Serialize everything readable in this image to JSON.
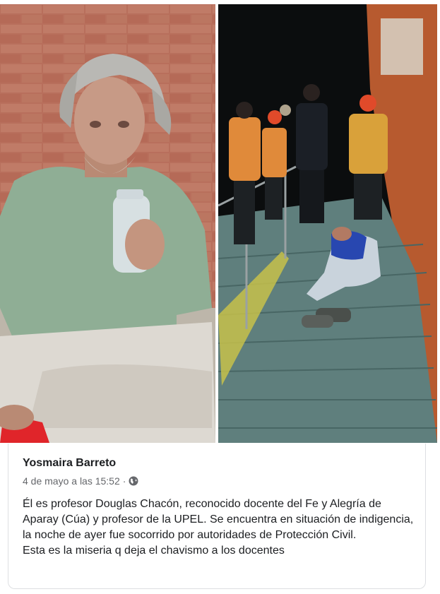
{
  "post": {
    "author": "Yosmaira Barreto",
    "timestamp": "4 de mayo a las 15:52",
    "separator": "·",
    "privacy_icon": "globe-icon",
    "text_paragraphs": [
      "Él es profesor Douglas Chacón, reconocido docente del Fe y Alegría de Aparay (Cúa) y profesor de la UPEL. Se encuentra en situación de indigencia, la noche de ayer fue socorrido por autoridades de Protección Civil.",
      "Esta es la miseria q deja el chavismo a los docentes"
    ]
  },
  "photos": [
    {
      "id": "photo-left"
    },
    {
      "id": "photo-right"
    }
  ],
  "colors": {
    "text_primary": "#1c1e21",
    "text_secondary": "#65676b",
    "card_border": "#dddfe2",
    "brick": "#b4735f",
    "night": "#0b0d0e",
    "vest_orange": "#e08a3a",
    "vest_yellow": "#d9a13a",
    "ramp": "#5f7f7d"
  }
}
